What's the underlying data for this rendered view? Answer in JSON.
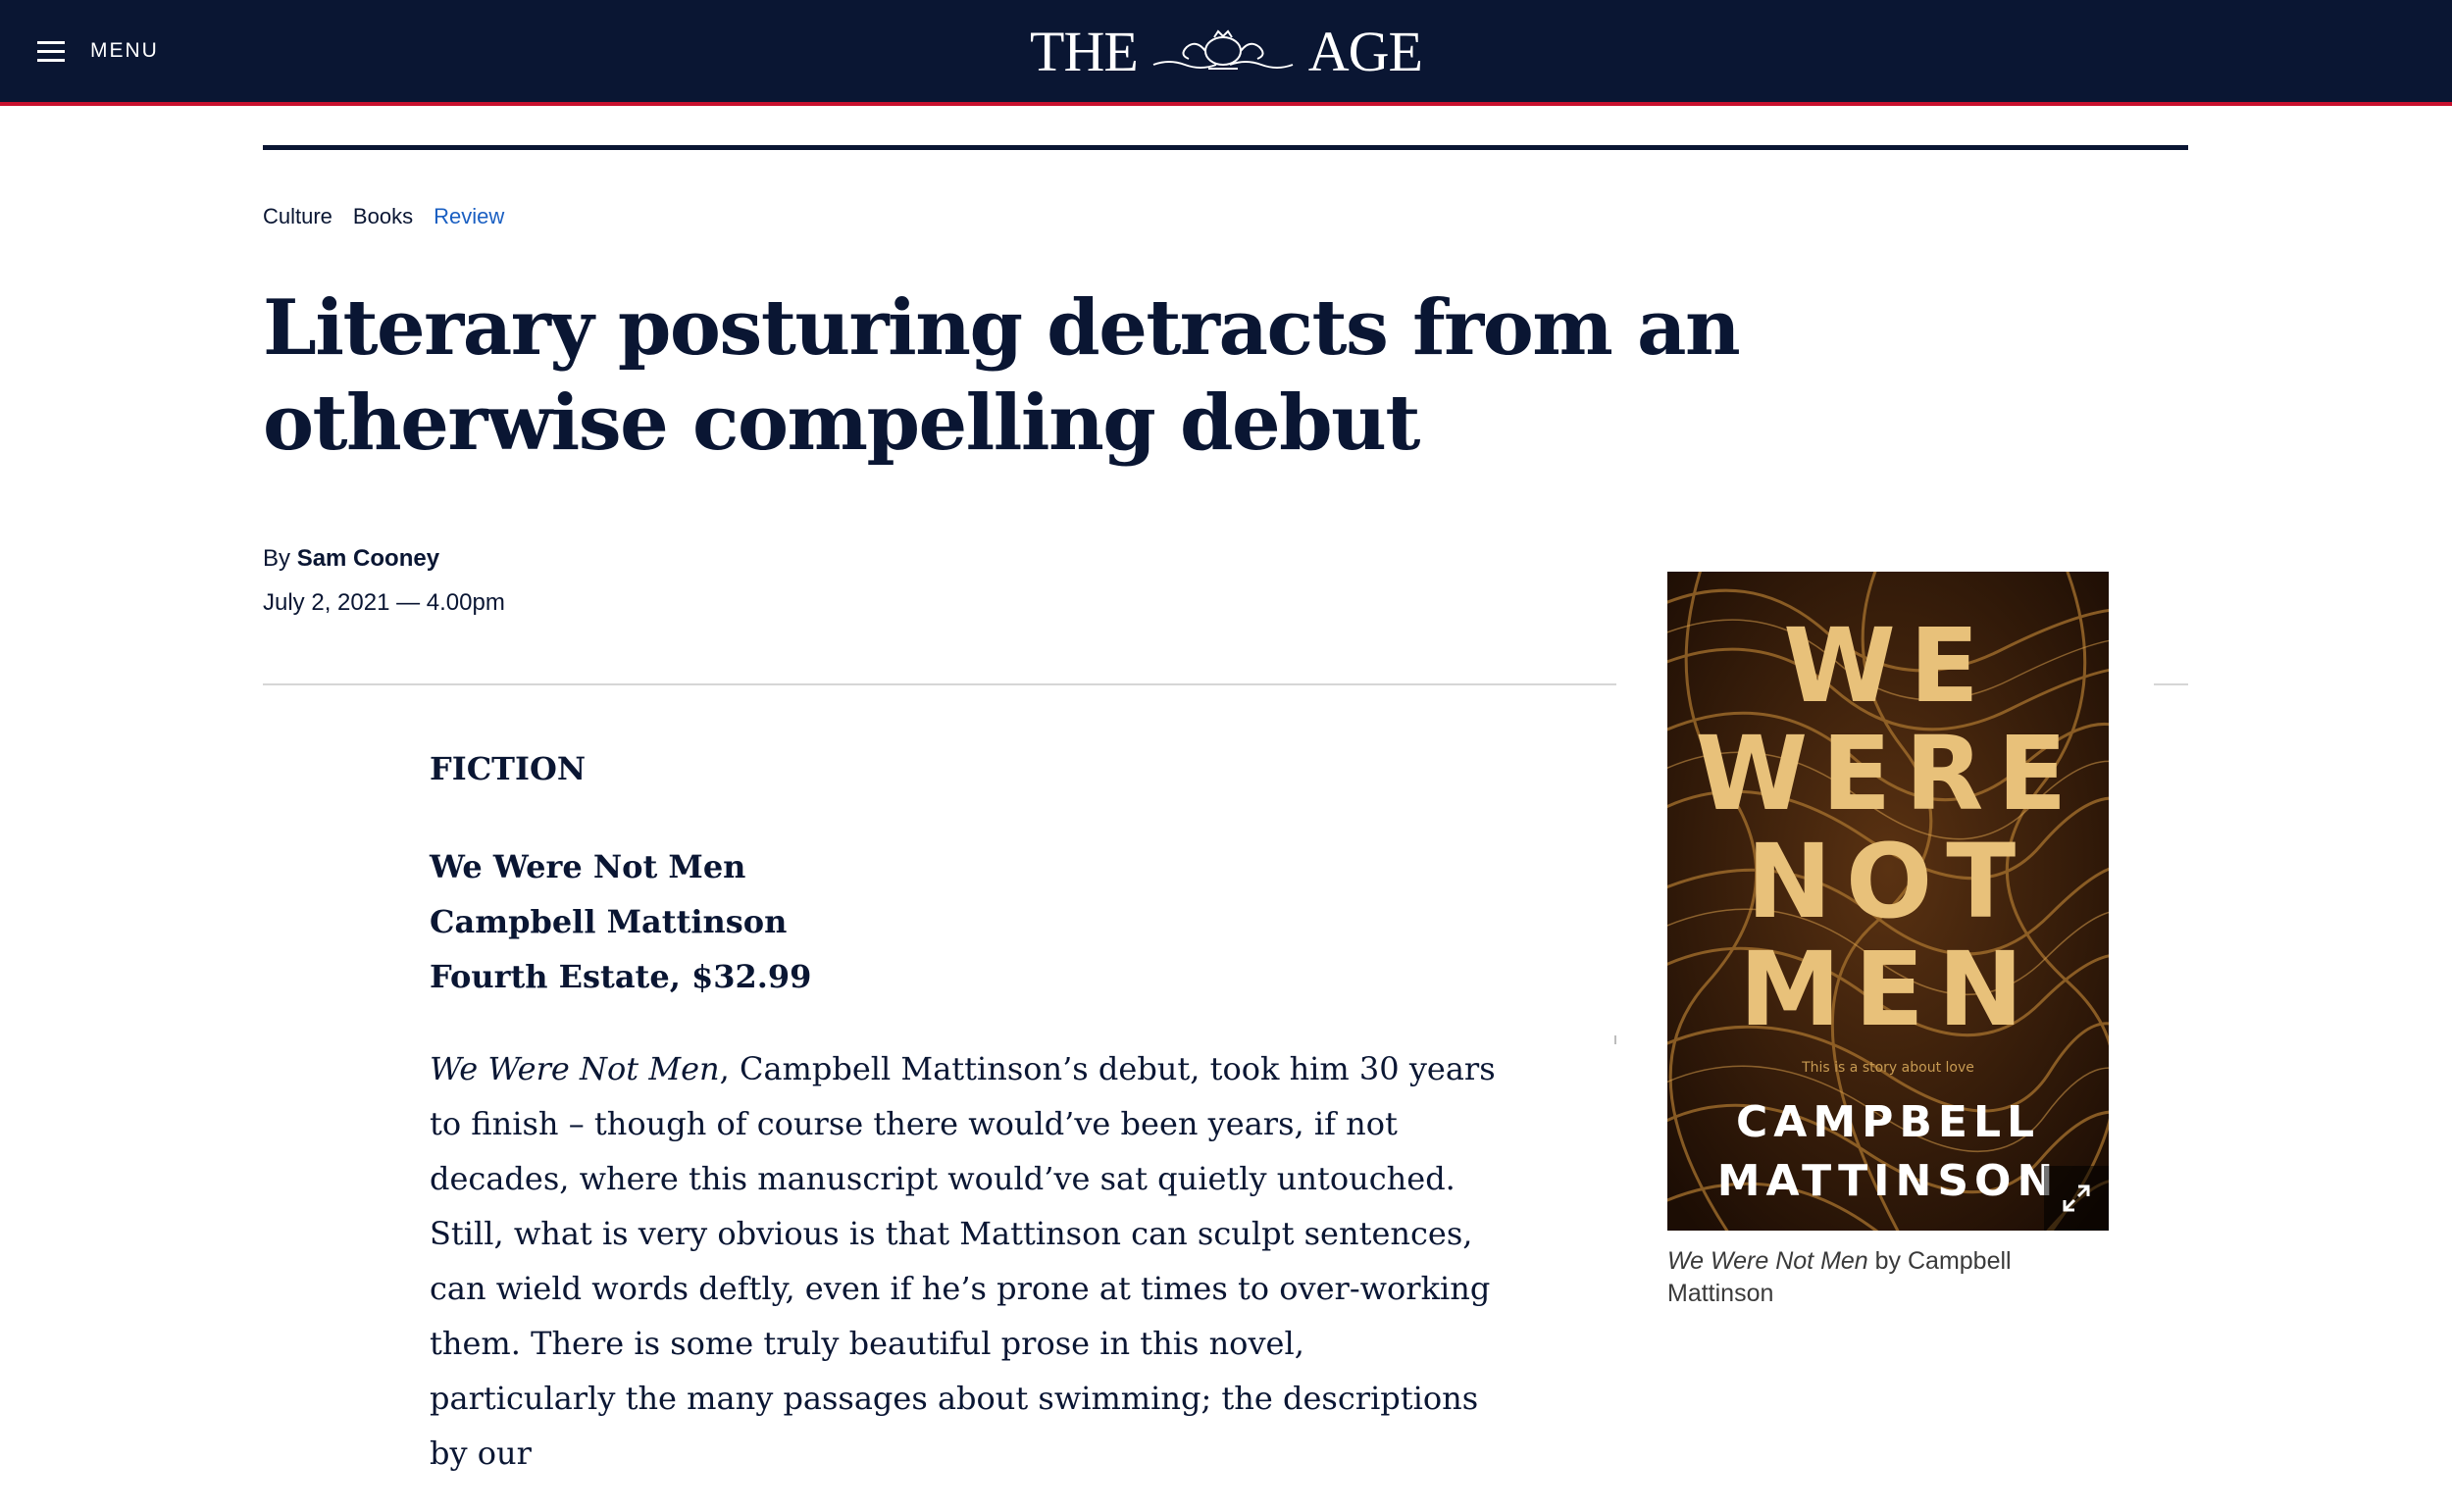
{
  "header": {
    "menu_label": "MENU",
    "masthead_left": "THE",
    "masthead_right": "AGE",
    "bg_color": "#0a1633",
    "accent_color": "#c8102e"
  },
  "breadcrumbs": [
    {
      "label": "Culture"
    },
    {
      "label": "Books"
    },
    {
      "label": "Review",
      "color": "#1a5fc2"
    }
  ],
  "article": {
    "headline": "Literary posturing detracts from an otherwise compelling debut",
    "byline_prefix": "By",
    "author": "Sam Cooney",
    "date": "July 2, 2021 — 4.00pm",
    "section_label": "FICTION",
    "book": {
      "title": "We Were Not Men",
      "author": "Campbell Mattinson",
      "publisher_price": "Fourth Estate, $32.99"
    },
    "paragraph": {
      "italic_title": "We Were Not Men",
      "text": ", Campbell Mattinson’s debut, took him 30 years to finish – though of course there would’ve been years, if not decades, where this manuscript would’ve sat quietly untouched. Still, what is very obvious is that Mattinson can sculpt sentences, can wield words deftly, even if he’s prone at times to over-working them. There is some truly beautiful prose in this novel, particularly the many passages about swimming; the descriptions by our"
    }
  },
  "cover": {
    "title_lines": [
      "WE",
      "WERE",
      "NOT",
      "MEN"
    ],
    "tagline": "This is a story about love",
    "author_lines": [
      "CAMPBELL",
      "MATTINSON"
    ],
    "expand_icon": "expand-icon",
    "caption_italic": "We Were Not Men",
    "caption_rest": " by Campbell Mattinson"
  }
}
